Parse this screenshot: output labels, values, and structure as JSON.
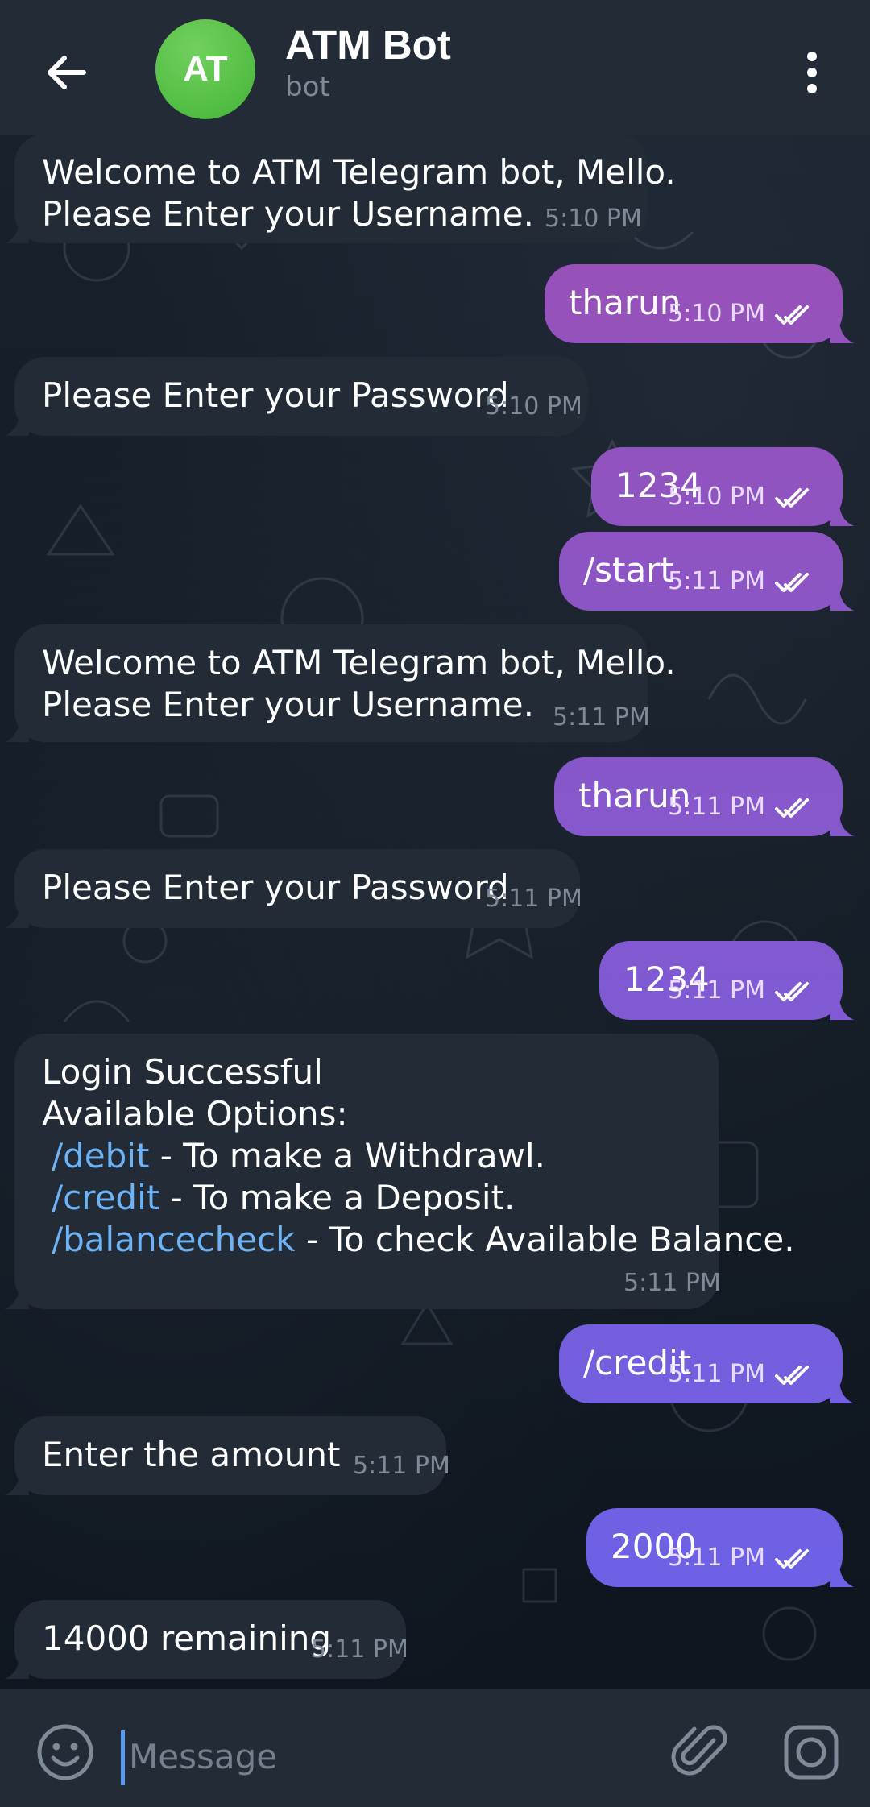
{
  "header": {
    "avatar_initials": "AT",
    "title": "ATM Bot",
    "subtitle": "bot"
  },
  "messages": [
    {
      "dir": "in",
      "lines": [
        "Welcome to ATM Telegram bot, Mello.",
        "Please Enter your Username."
      ],
      "time": "5:10 PM"
    },
    {
      "dir": "out",
      "text": "tharun",
      "time": "5:10 PM"
    },
    {
      "dir": "in",
      "lines": [
        "Please Enter your Password"
      ],
      "time": "5:10 PM"
    },
    {
      "dir": "out",
      "text": "1234",
      "time": "5:10 PM"
    },
    {
      "dir": "out",
      "text": "/start",
      "time": "5:11 PM"
    },
    {
      "dir": "in",
      "lines": [
        "Welcome to ATM Telegram bot, Mello.",
        "Please Enter your Username."
      ],
      "time": "5:11 PM"
    },
    {
      "dir": "out",
      "text": "tharun",
      "time": "5:11 PM"
    },
    {
      "dir": "in",
      "lines": [
        "Please Enter your Password"
      ],
      "time": "5:11 PM"
    },
    {
      "dir": "out",
      "text": "1234",
      "time": "5:11 PM"
    },
    {
      "dir": "in",
      "title_lines": [
        "Login Successful",
        "Available Options:"
      ],
      "options": [
        {
          "command": "/debit",
          "description": " - To make a Withdrawl."
        },
        {
          "command": "/credit",
          "description": " - To make a Deposit."
        },
        {
          "command": "/balancecheck",
          "description": " - To check Available Balance."
        }
      ],
      "time": "5:11 PM"
    },
    {
      "dir": "out",
      "text": "/credit",
      "time": "5:11 PM"
    },
    {
      "dir": "in",
      "lines": [
        "Enter the amount"
      ],
      "time": "5:11 PM"
    },
    {
      "dir": "out",
      "text": "2000",
      "time": "5:11 PM"
    },
    {
      "dir": "in",
      "lines": [
        "14000 remaining"
      ],
      "time": "5:11 PM"
    }
  ],
  "input": {
    "placeholder": "Message"
  },
  "icons": {
    "back": "arrow-left-icon",
    "menu": "more-vertical-icon",
    "emoji": "smile-icon",
    "attach": "paperclip-icon",
    "camera": "camera-icon",
    "read_receipt": "double-check-icon"
  },
  "colors": {
    "header_bg": "#222b36",
    "incoming_bubble": "#222b36",
    "outgoing_gradient_top": "#9b4fb5",
    "outgoing_gradient_bottom": "#6a62e9",
    "link": "#6db3f5",
    "avatar": "#55c146"
  }
}
